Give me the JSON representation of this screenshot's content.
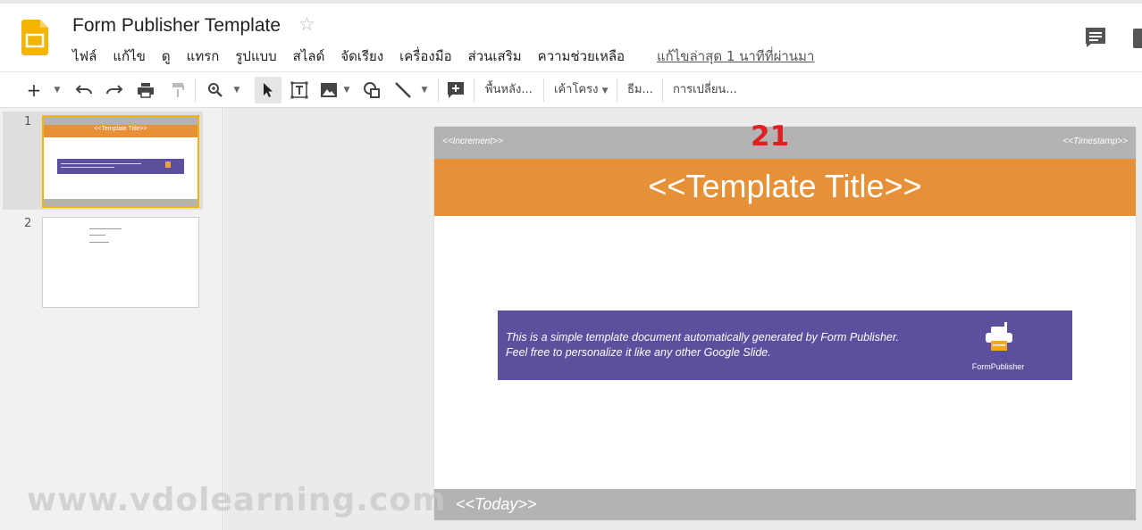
{
  "header": {
    "title": "Form Publisher Template",
    "last_edit": "แก้ไขล่าสุด 1 นาทีที่ผ่านมา"
  },
  "menu": [
    "ไฟล์",
    "แก้ไข",
    "ดู",
    "แทรก",
    "รูปแบบ",
    "สไลด์",
    "จัดเรียง",
    "เครื่องมือ",
    "ส่วนเสริม",
    "ความช่วยเหลือ"
  ],
  "toolbar": {
    "background_label": "พื้นหลัง...",
    "layout_label": "เค้าโครง",
    "theme_label": "ธีม...",
    "transition_label": "การเปลี่ยน..."
  },
  "filmstrip": {
    "slides": [
      {
        "number": "1",
        "title": "<<Template Title>>",
        "selected": true
      },
      {
        "number": "2",
        "selected": false
      }
    ]
  },
  "slide": {
    "increment": "<<Increment>>",
    "timestamp": "<<Timestamp>>",
    "title": "<<Template Title>>",
    "body_line1": "This is a simple template document automatically generated by Form Publisher.",
    "body_line2": "Feel free to personalize it like any other Google Slide.",
    "logo_label": "FormPublisher",
    "footer": "<<Today>>"
  },
  "overlay_number": "21",
  "watermark": "www.vdolearning.com",
  "colors": {
    "title_bar": "#e69138",
    "purple_box": "#5b4f9e",
    "gray_bar": "#b3b3b3",
    "app_logo": "#f4b400",
    "overlay": "#e02020"
  },
  "icons": [
    "slides-logo-icon",
    "star-icon",
    "comment-icon",
    "add-icon",
    "undo-icon",
    "redo-icon",
    "print-icon",
    "paint-format-icon",
    "zoom-icon",
    "select-icon",
    "textbox-icon",
    "image-icon",
    "shape-icon",
    "line-icon",
    "insert-comment-icon",
    "printer-icon"
  ]
}
